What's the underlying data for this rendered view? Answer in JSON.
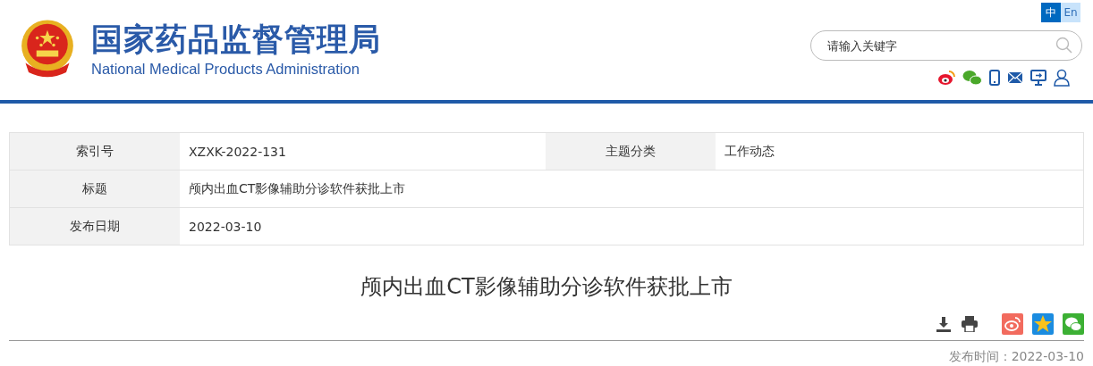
{
  "header": {
    "title_cn": "国家药品监督管理局",
    "title_en": "National Medical Products Administration"
  },
  "languages": [
    {
      "label": "中",
      "selected": true
    },
    {
      "label": "En",
      "selected": false
    }
  ],
  "search": {
    "placeholder": "请输入关键字"
  },
  "meta_table": {
    "rows": [
      [
        {
          "label": "索引号",
          "value": "XZXK-2022-131"
        },
        {
          "label": "主题分类",
          "value": "工作动态"
        }
      ],
      [
        {
          "label": "标题",
          "value": "颅内出血CT影像辅助分诊软件获批上市"
        }
      ],
      [
        {
          "label": "发布日期",
          "value": "2022-03-10"
        }
      ]
    ]
  },
  "article": {
    "title": "颅内出血CT影像辅助分诊软件获批上市",
    "publish_time": "发布时间：2022-03-10"
  }
}
